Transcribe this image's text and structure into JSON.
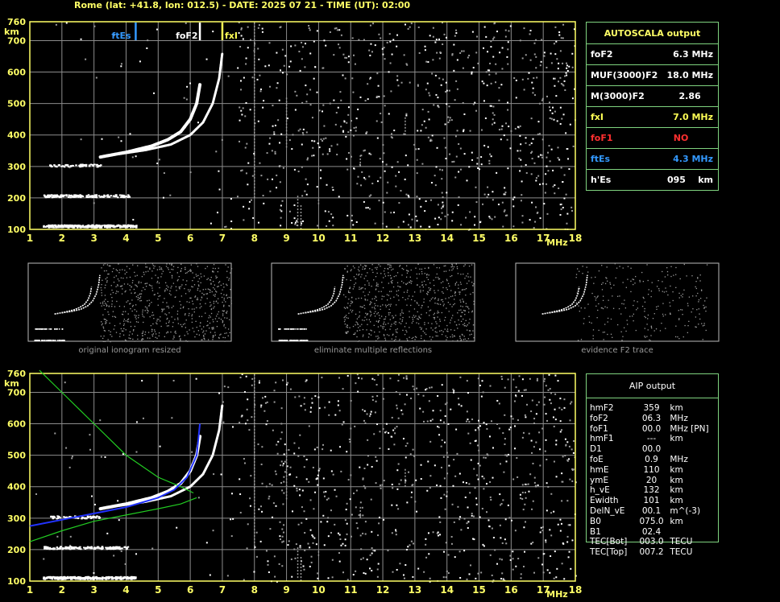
{
  "header": {
    "title": "Rome (lat: +41.8, lon: 012.5) - DATE: 2025 07 21 - TIME (UT): 02:00"
  },
  "autoscala": {
    "title": "AUTOSCALA output",
    "rows": [
      {
        "label": "foF2",
        "value": "6.3 MHz",
        "color": "#ffffff"
      },
      {
        "label": "MUF(3000)F2",
        "value": "18.0 MHz",
        "color": "#ffffff"
      },
      {
        "label": "M(3000)F2",
        "value": "2.86    ",
        "color": "#ffffff"
      },
      {
        "label": "fxI",
        "value": "7.0 MHz",
        "color": "#ffff55"
      },
      {
        "label": "foF1",
        "value": "NO        ",
        "color": "#ff3030"
      },
      {
        "label": "ftEs",
        "value": "4.3 MHz",
        "color": "#3399ff"
      },
      {
        "label": "h'Es",
        "value": "095    km",
        "color": "#ffffff"
      }
    ]
  },
  "aip": {
    "title": "AIP output",
    "rows": [
      {
        "name": "hmF2",
        "value": "359",
        "unit": "km"
      },
      {
        "name": "foF2",
        "value": "06.3",
        "unit": "MHz"
      },
      {
        "name": "foF1",
        "value": "00.0",
        "unit": "MHz   [PN]"
      },
      {
        "name": "hmF1",
        "value": "---",
        "unit": "km"
      },
      {
        "name": "D1",
        "value": "00.0",
        "unit": ""
      },
      {
        "name": "foE",
        "value": "0.9",
        "unit": "MHz"
      },
      {
        "name": "hmE",
        "value": "110",
        "unit": "km"
      },
      {
        "name": "ymE",
        "value": "20",
        "unit": "km"
      },
      {
        "name": "h_vE",
        "value": "132",
        "unit": "km"
      },
      {
        "name": "Ewidth",
        "value": "101",
        "unit": "km"
      },
      {
        "name": "DelN_vE",
        "value": "00.1",
        "unit": "m^(-3)"
      },
      {
        "name": "B0",
        "value": "075.0",
        "unit": "km"
      },
      {
        "name": "B1",
        "value": "02.4",
        "unit": ""
      },
      {
        "name": "TEC[Bot]",
        "value": "003.0",
        "unit": "TECU"
      },
      {
        "name": "TEC[Top]",
        "value": "007.2",
        "unit": "TECU"
      }
    ]
  },
  "mini": {
    "captions": [
      "original ionogram resized",
      "eliminate multiple reflections",
      "evidence F2 trace"
    ]
  },
  "colors": {
    "grid": "#8c8c8c",
    "frame": "#ffff66",
    "trace": "#ffffff",
    "noise": "#9a9a9a",
    "es_marker": "#3399ff",
    "fof2_marker": "#ffffff",
    "fxi_marker": "#ffff55",
    "profile": "#22cc22",
    "aip_trace": "#2233ff"
  },
  "chart_data": [
    {
      "type": "scatter",
      "name": "ionogram-autoscala",
      "xlabel": "MHz",
      "ylabel": "km",
      "xlim": [
        1,
        18
      ],
      "ylim": [
        100,
        760
      ],
      "x_ticks": [
        1,
        2,
        3,
        4,
        5,
        6,
        7,
        8,
        9,
        10,
        11,
        12,
        13,
        14,
        15,
        16,
        17,
        18
      ],
      "y_ticks": [
        100,
        200,
        300,
        400,
        500,
        600,
        700,
        760
      ],
      "grid": true,
      "markers": [
        {
          "label": "ftEs",
          "freq": 4.3
        },
        {
          "label": "foF2",
          "freq": 6.3
        },
        {
          "label": "fxI",
          "freq": 7.0
        }
      ],
      "traces": {
        "es_layer": {
          "freq_range": [
            1.4,
            4.3
          ],
          "height": 112
        },
        "es_second_hop": {
          "freq_range": [
            1.4,
            4.1
          ],
          "height": 208
        },
        "es_third_hop": {
          "freq_range": [
            1.6,
            3.2
          ],
          "height": 305
        },
        "o_trace": [
          [
            3.2,
            330
          ],
          [
            4.0,
            345
          ],
          [
            4.8,
            365
          ],
          [
            5.3,
            385
          ],
          [
            5.7,
            410
          ],
          [
            6.0,
            450
          ],
          [
            6.2,
            500
          ],
          [
            6.3,
            560
          ]
        ],
        "x_trace": [
          [
            3.8,
            340
          ],
          [
            4.6,
            352
          ],
          [
            5.4,
            370
          ],
          [
            6.0,
            400
          ],
          [
            6.4,
            440
          ],
          [
            6.7,
            500
          ],
          [
            6.9,
            580
          ],
          [
            7.0,
            660
          ]
        ]
      }
    },
    {
      "type": "line",
      "name": "ionogram-aip",
      "xlabel": "MHz",
      "ylabel": "km",
      "xlim": [
        1,
        18
      ],
      "ylim": [
        100,
        760
      ],
      "x_ticks": [
        1,
        2,
        3,
        4,
        5,
        6,
        7,
        8,
        9,
        10,
        11,
        12,
        13,
        14,
        15,
        16,
        17,
        18
      ],
      "y_ticks": [
        100,
        200,
        300,
        400,
        500,
        600,
        700,
        760
      ],
      "grid": true,
      "fitted_trace": [
        [
          1.0,
          275
        ],
        [
          2.0,
          295
        ],
        [
          3.0,
          315
        ],
        [
          4.0,
          335
        ],
        [
          5.0,
          365
        ],
        [
          5.5,
          390
        ],
        [
          5.9,
          430
        ],
        [
          6.2,
          500
        ],
        [
          6.3,
          600
        ]
      ],
      "profile_upper": [
        [
          1.3,
          770
        ],
        [
          2.0,
          700
        ],
        [
          3.0,
          600
        ],
        [
          4.0,
          500
        ],
        [
          5.0,
          430
        ],
        [
          5.7,
          400
        ],
        [
          6.1,
          380
        ]
      ],
      "profile_lower": [
        [
          1.0,
          225
        ],
        [
          2.0,
          260
        ],
        [
          3.0,
          290
        ],
        [
          4.0,
          310
        ],
        [
          5.0,
          330
        ],
        [
          5.7,
          345
        ],
        [
          6.2,
          365
        ]
      ]
    }
  ]
}
